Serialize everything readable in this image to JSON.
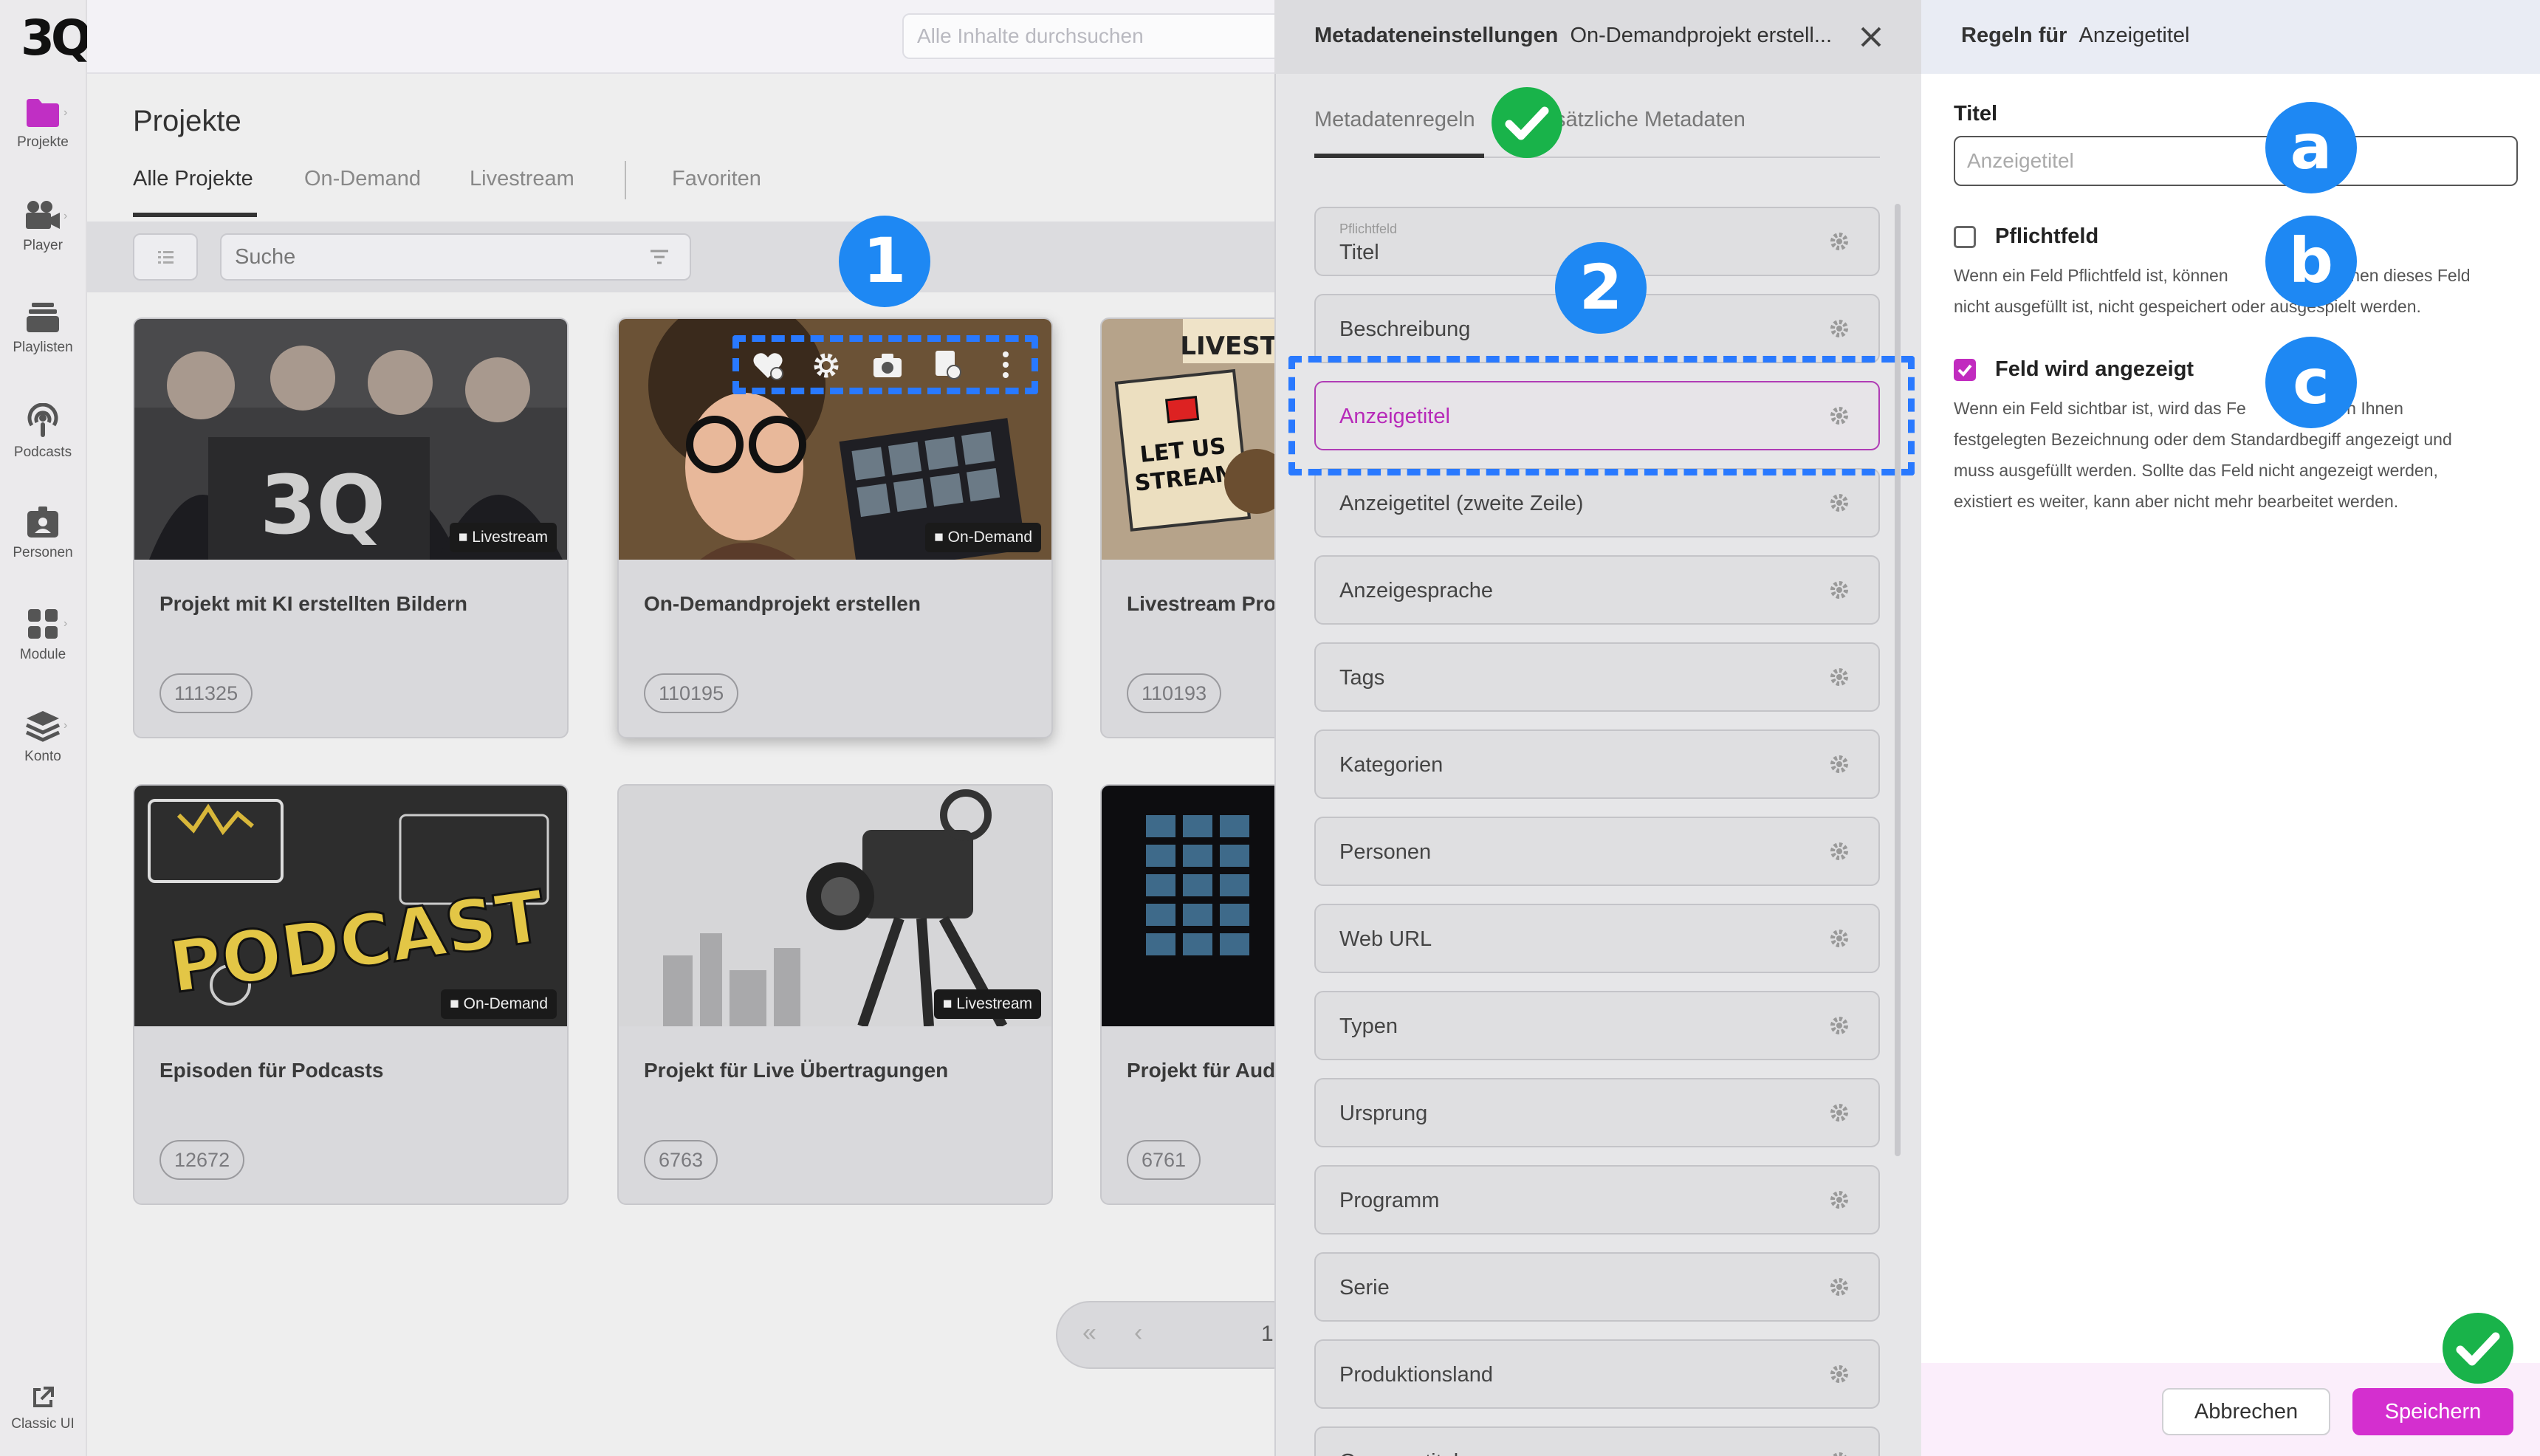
{
  "brand": {
    "logo": "3Q",
    "accent": "#d42fcf",
    "annotation": "#1e88f3"
  },
  "sidebar": {
    "items": [
      {
        "label": "Projekte",
        "icon": "folder-icon"
      },
      {
        "label": "Player",
        "icon": "video-camera-icon"
      },
      {
        "label": "Playlisten",
        "icon": "playlist-icon"
      },
      {
        "label": "Podcasts",
        "icon": "podcast-icon"
      },
      {
        "label": "Personen",
        "icon": "person-badge-icon"
      },
      {
        "label": "Module",
        "icon": "modules-icon"
      },
      {
        "label": "Konto",
        "icon": "layers-icon"
      }
    ],
    "classic": {
      "label": "Classic UI",
      "icon": "external-link-icon"
    }
  },
  "header": {
    "search_placeholder": "Alle Inhalte durchsuchen"
  },
  "main": {
    "title": "Projekte",
    "tabs": [
      "Alle Projekte",
      "On-Demand",
      "Livestream",
      "Favoriten"
    ],
    "search_placeholder": "Suche",
    "projects": [
      {
        "title": "Projekt mit KI erstellten Bildern",
        "id": "111325",
        "badge": "Livestream",
        "image_text": "3Q"
      },
      {
        "title": "On-Demandprojekt erstellen",
        "id": "110195",
        "badge": "On-Demand"
      },
      {
        "title": "Livestream Proj",
        "id": "110193",
        "image_text": "LIVESTREA",
        "sign_text": "LET US STREAM"
      },
      {
        "title": "Episoden für Podcasts",
        "id": "12672",
        "badge": "On-Demand",
        "image_text": "PODCAST"
      },
      {
        "title": "Projekt für Live Übertragungen",
        "id": "6763",
        "badge": "Livestream"
      },
      {
        "title": "Projekt für Aud",
        "id": "6761"
      }
    ],
    "pager_page": "1"
  },
  "meta_panel": {
    "heading": "Metadateneinstellungen",
    "project": "On-Demandprojekt erstell...",
    "tabs": [
      "Metadatenregeln",
      "sätzliche Metadaten"
    ],
    "required_hint": "Pflichtfeld",
    "fields": [
      "Titel",
      "Beschreibung",
      "Anzeigetitel",
      "Anzeigetitel (zweite Zeile)",
      "Anzeigesprache",
      "Tags",
      "Kategorien",
      "Personen",
      "Web URL",
      "Typen",
      "Ursprung",
      "Programm",
      "Serie",
      "Produktionsland",
      "Gesangstitel"
    ],
    "selected_field": "Anzeigetitel"
  },
  "rules_panel": {
    "heading": "Regeln für",
    "field": "Anzeigetitel",
    "title_label": "Titel",
    "title_placeholder": "Anzeigetitel",
    "required": {
      "label": "Pflichtfeld",
      "checked": false,
      "desc_1": "Wenn ein Feld Pflichtfeld ist, können",
      "desc_2": "denen dieses Feld",
      "desc_3": "nicht ausgefüllt ist, nicht gespeichert oder ausgespielt werden."
    },
    "visible": {
      "label": "Feld wird angezeigt",
      "checked": true,
      "desc_1a": "Wenn ein Feld sichtbar ist, wird das Fe",
      "desc_1b": "von Ihnen",
      "desc_2": "festgelegten Bezeichnung oder dem Standardbegiff angezeigt und",
      "desc_3": "muss ausgefüllt werden. Sollte das Feld nicht angezeigt werden,",
      "desc_4": "existiert es weiter, kann aber nicht mehr bearbeitet werden."
    },
    "cancel_label": "Abbrechen",
    "save_label": "Speichern"
  },
  "annotations": {
    "m1": "1",
    "m2": "2",
    "ma": "a",
    "mb": "b",
    "mc": "c"
  }
}
